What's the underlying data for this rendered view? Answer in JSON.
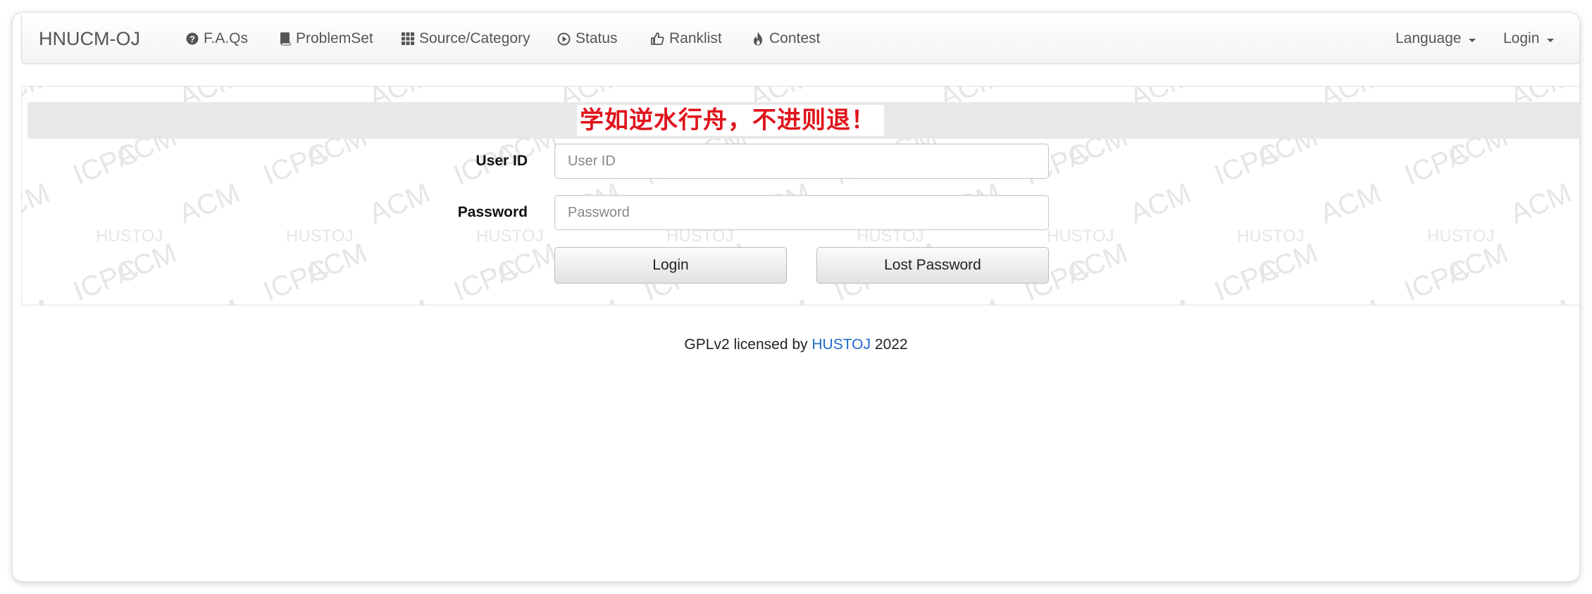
{
  "navbar": {
    "brand": "HNUCM-OJ",
    "items": [
      {
        "label": "F.A.Qs",
        "icon": "question-circle-icon"
      },
      {
        "label": "ProblemSet",
        "icon": "book-icon"
      },
      {
        "label": "Source/Category",
        "icon": "grid-icon"
      },
      {
        "label": "Status",
        "icon": "play-circle-icon"
      },
      {
        "label": "Ranklist",
        "icon": "thumbs-up-icon"
      },
      {
        "label": "Contest",
        "icon": "fire-icon"
      }
    ],
    "language_label": "Language",
    "login_label": "Login"
  },
  "main": {
    "motto": "学如逆水行舟，不进则退！",
    "watermark_words": [
      "ACM",
      "HUSTOJ",
      "ICPC"
    ],
    "form": {
      "user_id_label": "User ID",
      "user_id_placeholder": "User ID",
      "user_id_value": "",
      "password_label": "Password",
      "password_placeholder": "Password",
      "password_value": "",
      "login_button": "Login",
      "lost_password_button": "Lost Password"
    }
  },
  "footer": {
    "prefix": "GPLv2 licensed by",
    "link_text": "HUSTOJ",
    "year": "2022"
  },
  "colors": {
    "motto_red": "#e0131b",
    "link_blue": "#1e6ac8",
    "motto_bar_gray": "#e8e8e8"
  }
}
